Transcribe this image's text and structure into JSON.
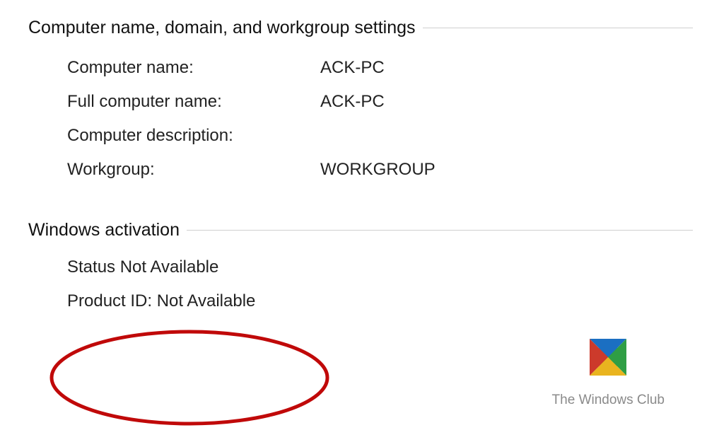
{
  "sections": {
    "computer": {
      "title": "Computer name, domain, and workgroup settings",
      "rows": {
        "computer_name": {
          "label": "Computer name:",
          "value": "ACK-PC"
        },
        "full_name": {
          "label": "Full computer name:",
          "value": "ACK-PC"
        },
        "description": {
          "label": "Computer description:",
          "value": ""
        },
        "workgroup": {
          "label": "Workgroup:",
          "value": "WORKGROUP"
        }
      }
    },
    "activation": {
      "title": "Windows activation",
      "status_line": "Status Not Available",
      "product_id_line": "Product ID:  Not Available"
    }
  },
  "annotation": {
    "ellipse_color": "#c00909"
  },
  "branding": {
    "text": "The Windows Club",
    "logo_colors": {
      "top": "#1b6fc2",
      "right": "#2f9e44",
      "bottom": "#e9b41f",
      "left": "#cc3a2b"
    }
  }
}
